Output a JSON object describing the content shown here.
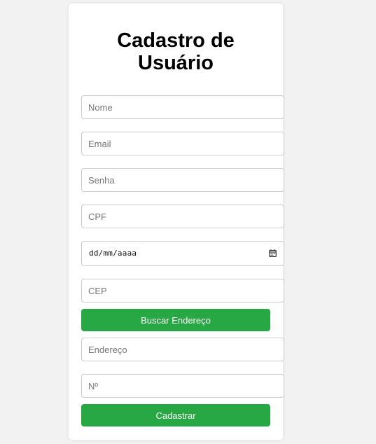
{
  "form": {
    "title_line1": "Cadastro de",
    "title_line2": "Usuário",
    "fields": {
      "nome": {
        "placeholder": "Nome"
      },
      "email": {
        "placeholder": "Email"
      },
      "senha": {
        "placeholder": "Senha"
      },
      "cpf": {
        "placeholder": "CPF"
      },
      "nascimento": {
        "placeholder": "dd/mm/aaaa",
        "icon": "calendar-icon"
      },
      "cep": {
        "placeholder": "CEP"
      },
      "endereco": {
        "placeholder": "Endereço"
      },
      "numero": {
        "placeholder": "Nº"
      }
    },
    "buttons": {
      "buscar": "Buscar Endereço",
      "cadastrar": "Cadastrar"
    }
  },
  "colors": {
    "button_green": "#28a745",
    "background": "#f2f2f2"
  }
}
